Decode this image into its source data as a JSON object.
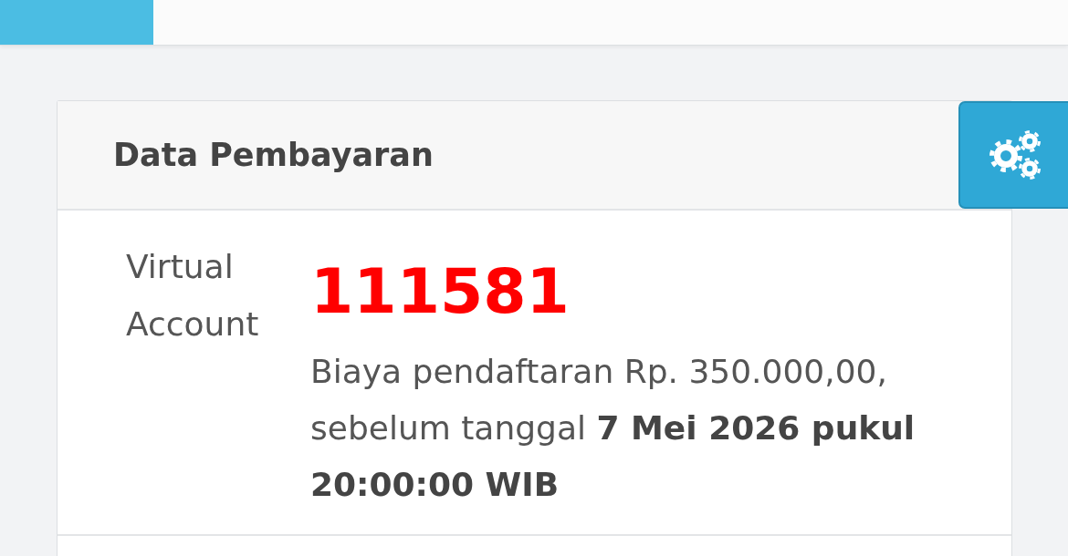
{
  "card": {
    "title": "Data Pembayaran",
    "fields": [
      {
        "label": "Virtual Account",
        "value": "111581",
        "note": "Biaya pendaftaran Rp. 350.000,00, sebelum tanggal **7 Mei 2026 pukul 20:00:00 WIB**"
      }
    ]
  }
}
